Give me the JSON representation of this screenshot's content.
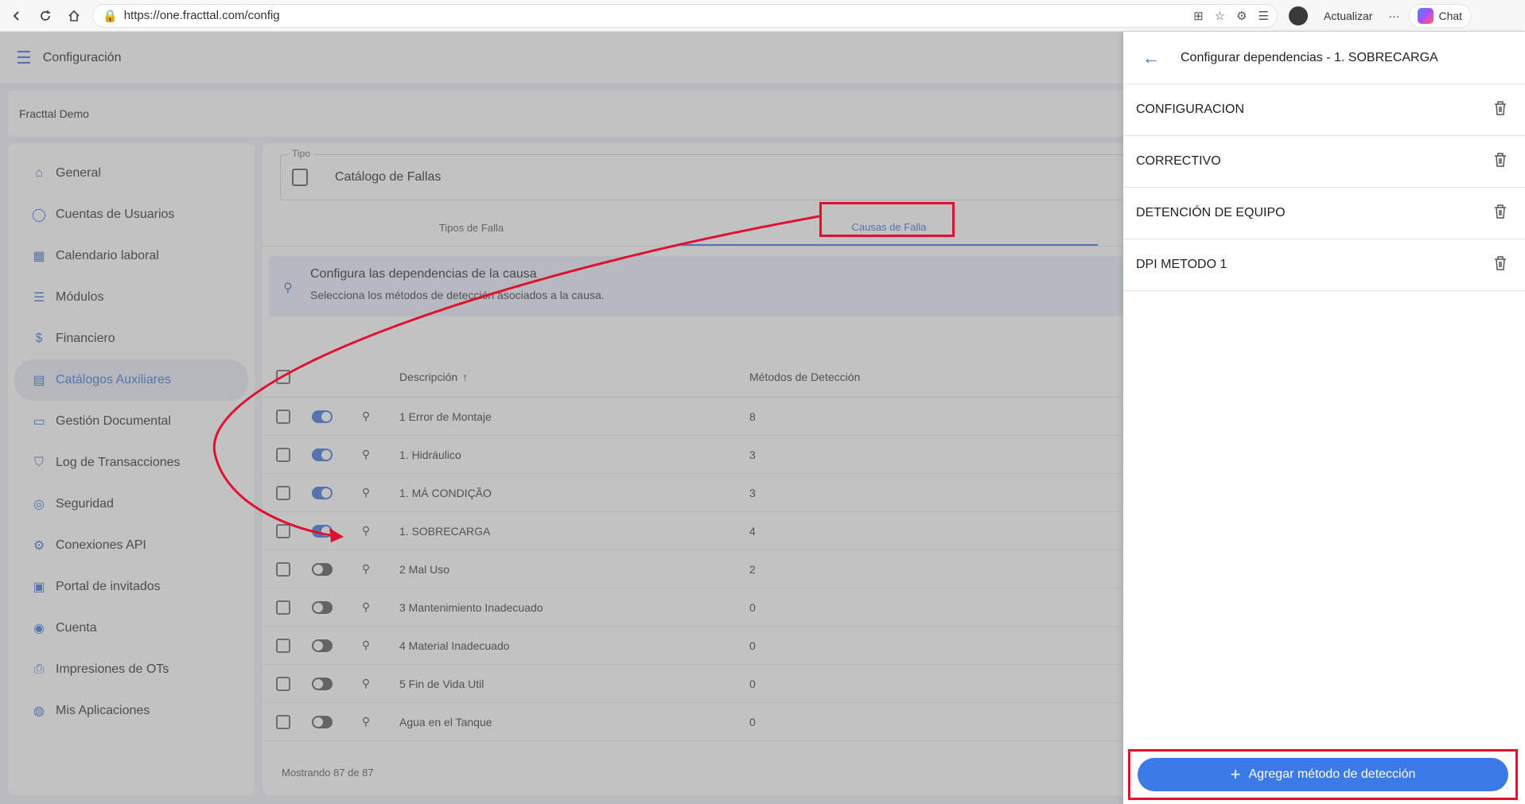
{
  "browser": {
    "url": "https://one.fracttal.com/config",
    "update_label": "Actualizar",
    "more_label": "···",
    "chat_label": "Chat"
  },
  "app": {
    "title": "Configuración",
    "company": "Fracttal Demo"
  },
  "sidebar": {
    "items": [
      {
        "label": "General",
        "icon": "home-icon"
      },
      {
        "label": "Cuentas de Usuarios",
        "icon": "user-icon"
      },
      {
        "label": "Calendario laboral",
        "icon": "calendar-icon"
      },
      {
        "label": "Módulos",
        "icon": "list-icon"
      },
      {
        "label": "Financiero",
        "icon": "dollar-icon"
      },
      {
        "label": "Catálogos Auxiliares",
        "icon": "catalog-icon",
        "active": true
      },
      {
        "label": "Gestión Documental",
        "icon": "document-icon"
      },
      {
        "label": "Log de Transacciones",
        "icon": "log-icon"
      },
      {
        "label": "Seguridad",
        "icon": "security-icon"
      },
      {
        "label": "Conexiones API",
        "icon": "api-icon"
      },
      {
        "label": "Portal de invitados",
        "icon": "portal-icon"
      },
      {
        "label": "Cuenta",
        "icon": "account-icon"
      },
      {
        "label": "Impresiones de OTs",
        "icon": "printer-icon"
      },
      {
        "label": "Mis Aplicaciones",
        "icon": "globe-icon"
      }
    ]
  },
  "content": {
    "tipo_label": "Tipo",
    "tipo_value": "Catálogo de Fallas",
    "tabs": [
      "Tipos de Falla",
      "Causas de Falla"
    ],
    "info_title": "Configura las dependencias de la causa",
    "info_sub": "Selecciona los métodos de detección asociados a la causa.",
    "table": {
      "col_desc": "Descripción",
      "col_met": "Métodos de Detección",
      "rows": [
        {
          "desc": "1 Error de Montaje",
          "met": "8",
          "on": true
        },
        {
          "desc": "1. Hidráulico",
          "met": "3",
          "on": true
        },
        {
          "desc": "1. MÁ CONDIÇÃO",
          "met": "3",
          "on": true
        },
        {
          "desc": "1. SOBRECARGA",
          "met": "4",
          "on": true
        },
        {
          "desc": "2 Mal Uso",
          "met": "2",
          "on": false
        },
        {
          "desc": "3 Mantenimiento Inadecuado",
          "met": "0",
          "on": false
        },
        {
          "desc": "4 Material Inadecuado",
          "met": "0",
          "on": false
        },
        {
          "desc": "5 Fin de Vida Util",
          "met": "0",
          "on": false
        },
        {
          "desc": "Agua en el Tanque",
          "met": "0",
          "on": false
        }
      ]
    },
    "footer": "Mostrando 87 de 87"
  },
  "drawer": {
    "title": "Configurar dependencias - 1. SOBRECARGA",
    "items": [
      "CONFIGURACION",
      "CORRECTIVO",
      "DETENCIÓN DE EQUIPO",
      "DPI METODO 1"
    ],
    "add_label": "Agregar método de detección"
  }
}
